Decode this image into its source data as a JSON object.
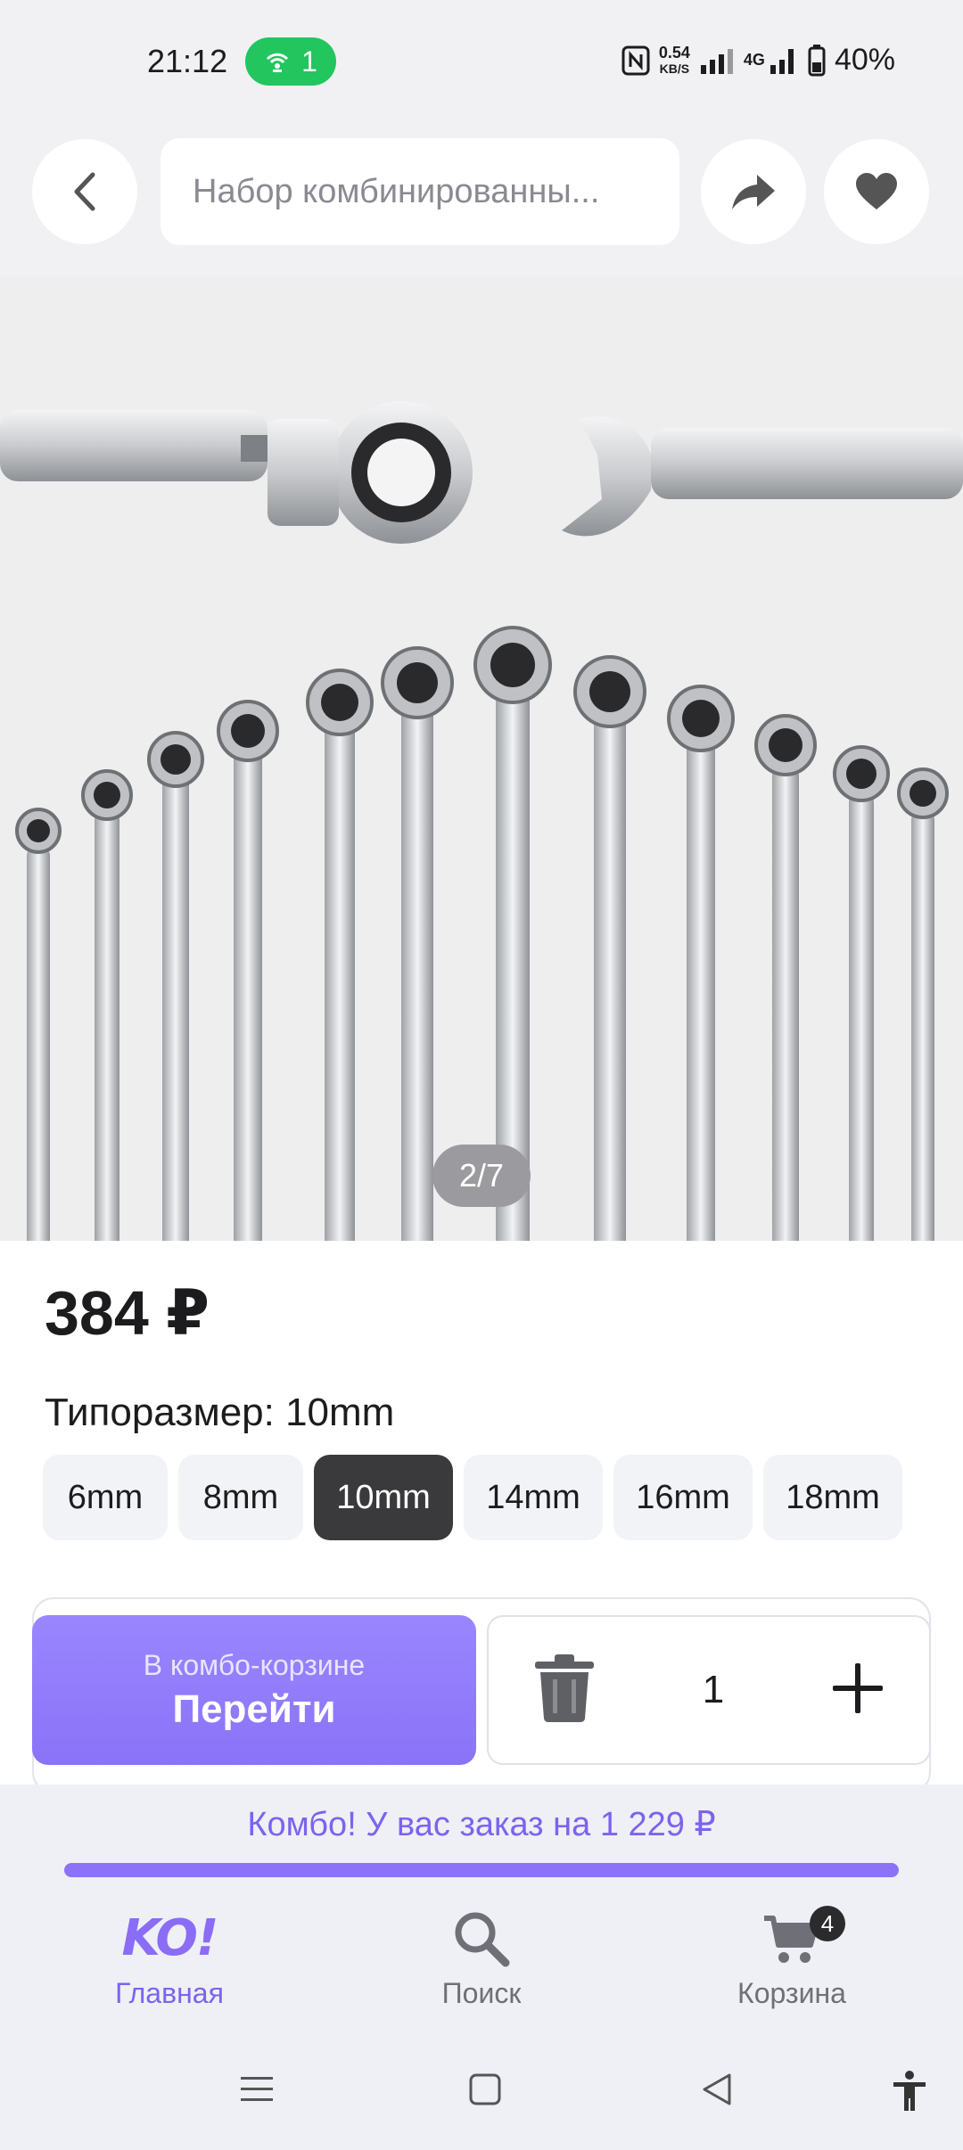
{
  "status_bar": {
    "time": "21:12",
    "hotspot_count": "1",
    "net_speed_value": "0.54",
    "net_speed_unit": "KB/S",
    "network_type": "4G",
    "battery": "40%"
  },
  "header": {
    "search_text": "Набор комбинированны..."
  },
  "gallery": {
    "counter": "2/7"
  },
  "product": {
    "price": "384 ₽",
    "size_label": "Типоразмер: 10mm",
    "sizes": [
      "6mm",
      "8mm",
      "10mm",
      "14mm",
      "16mm",
      "18mm"
    ],
    "selected_size": "10mm"
  },
  "cart_bar": {
    "go_subtitle": "В комбо-корзине",
    "go_label": "Перейти",
    "quantity": "1"
  },
  "combo": {
    "text": "Комбо! У вас заказ на 1 229 ₽",
    "progress": 1.0
  },
  "nav": {
    "home_label": "Главная",
    "home_logo": "KO!",
    "search_label": "Поиск",
    "cart_label": "Корзина",
    "cart_badge": "4"
  },
  "colors": {
    "accent": "#8b72f7",
    "hotspot_green": "#22c55e",
    "chip_active": "#3a3a3c"
  },
  "icons": [
    "back-arrow-icon",
    "share-icon",
    "heart-icon",
    "trash-icon",
    "plus-icon",
    "search-icon",
    "cart-icon",
    "menu-icon",
    "home-square-icon",
    "back-triangle-icon",
    "accessibility-icon"
  ]
}
